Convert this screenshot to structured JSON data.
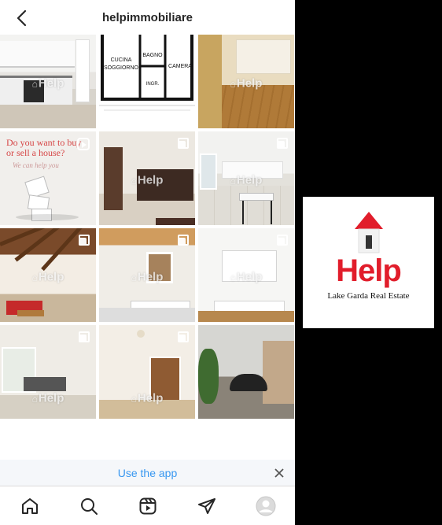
{
  "header": {
    "username": "helpimmobiliare"
  },
  "posts": [
    {
      "kind": "kitchen1",
      "watermark": "Help",
      "type": "none"
    },
    {
      "kind": "plan",
      "watermark": "",
      "type": "none",
      "rooms": [
        "CUCINA",
        "SOGGIORNO",
        "BAGNO",
        "CAMERA",
        "INGR."
      ]
    },
    {
      "kind": "wood",
      "watermark": "Help",
      "type": "none"
    },
    {
      "kind": "ad",
      "watermark": "",
      "type": "reel",
      "headline": "Do you want to buy or sell a house?",
      "sub": "We can help you"
    },
    {
      "kind": "dark",
      "watermark": "Help",
      "type": "multi"
    },
    {
      "kind": "tiles",
      "watermark": "Help",
      "type": "multi"
    },
    {
      "kind": "loft",
      "watermark": "Help",
      "type": "multi"
    },
    {
      "kind": "bright",
      "watermark": "Help",
      "type": "multi"
    },
    {
      "kind": "white",
      "watermark": "Help",
      "type": "multi"
    },
    {
      "kind": "living",
      "watermark": "Help",
      "type": "multi"
    },
    {
      "kind": "hall",
      "watermark": "Help",
      "type": "multi"
    },
    {
      "kind": "street",
      "watermark": "",
      "type": "none"
    }
  ],
  "banner": {
    "cta": "Use the app"
  },
  "nav": [
    "home-icon",
    "search-icon",
    "reels-icon",
    "direct-icon",
    "profile-icon"
  ],
  "logo": {
    "word": "Help",
    "tagline": "Lake Garda Real Estate",
    "brand_red": "#e11d2b"
  },
  "colors": {
    "link_blue": "#3897f0",
    "text_dark": "#262626"
  }
}
